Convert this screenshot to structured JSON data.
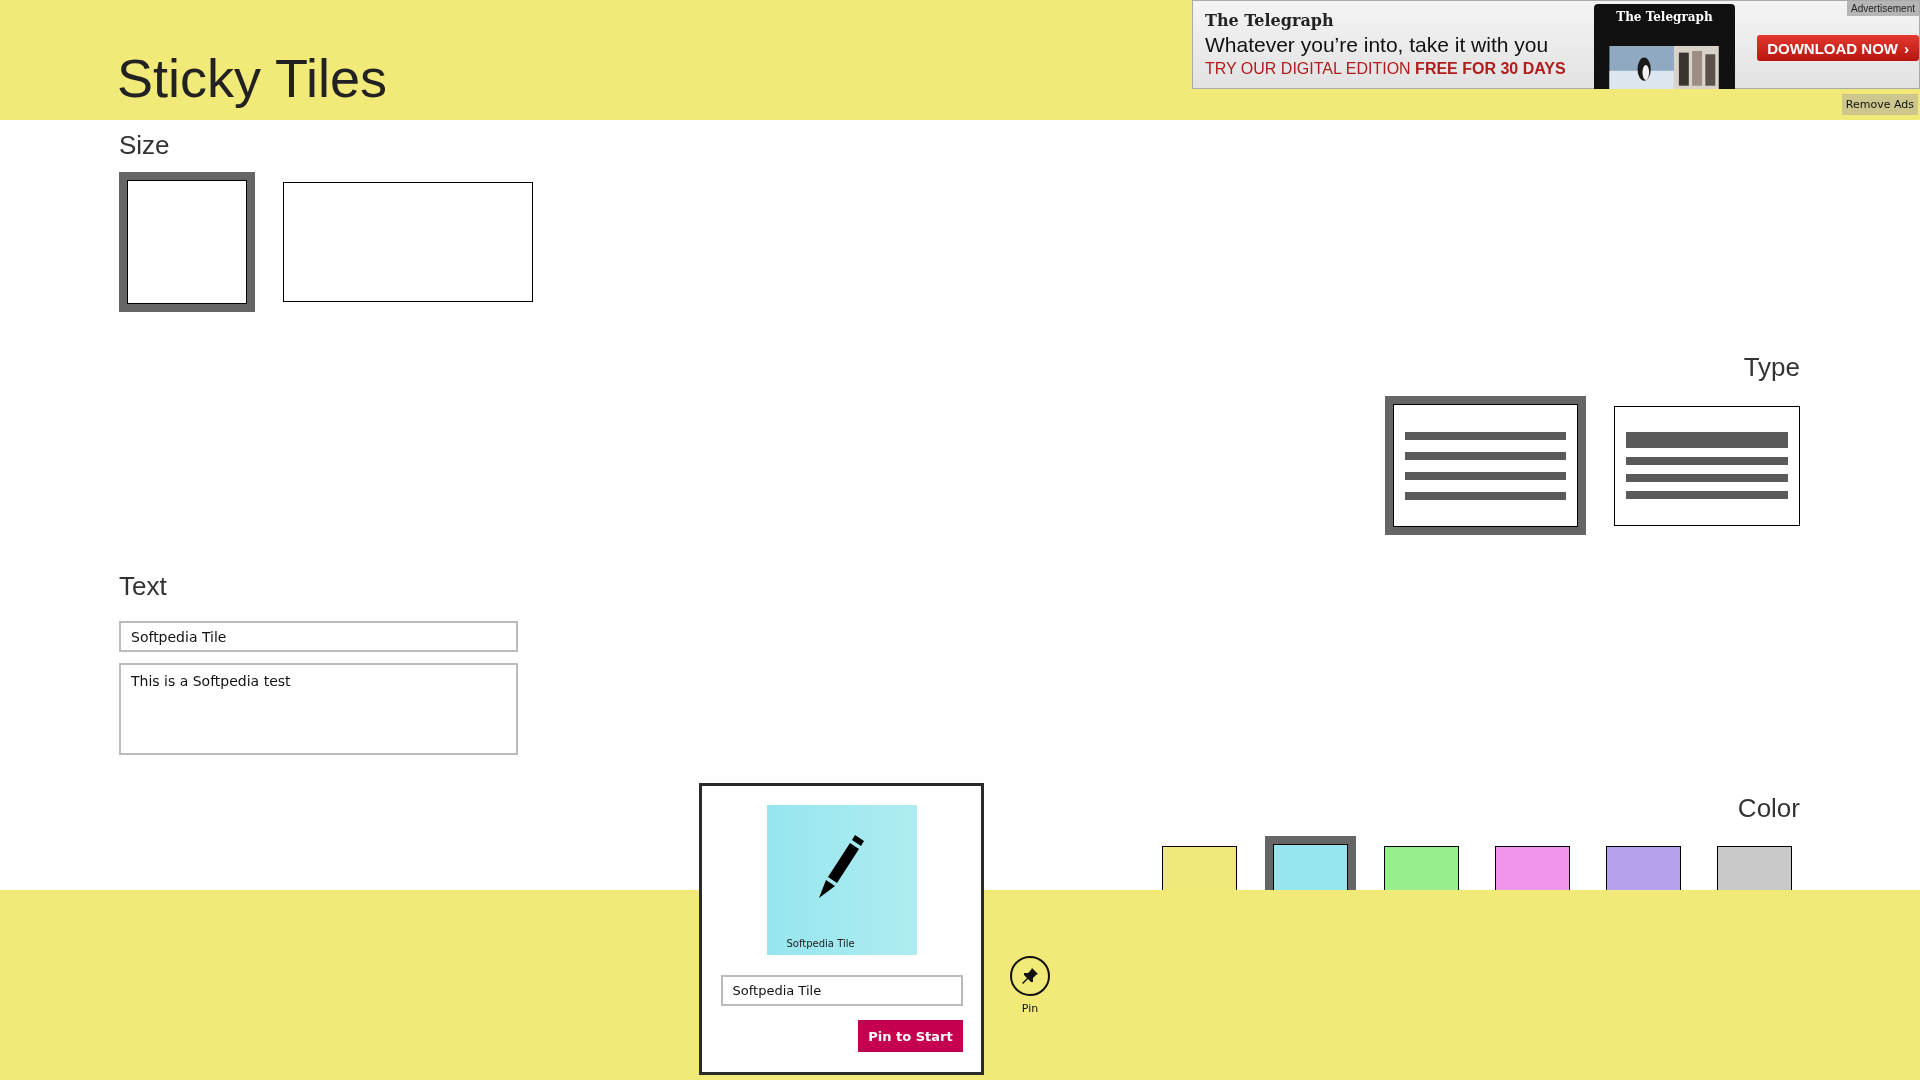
{
  "app": {
    "title": "Sticky Tiles"
  },
  "ad": {
    "brand": "The Telegraph",
    "headline": "Whatever you’re into, take it with you",
    "offer": "TRY OUR DIGITAL EDITION **FREE FOR 30 DAYS**",
    "device_brand": "The Telegraph",
    "cta": "DOWNLOAD NOW",
    "cta_icon": "›",
    "label": "Advertisement"
  },
  "remove_ads": "Remove Ads",
  "size": {
    "label": "Size",
    "options": [
      {
        "kind": "square",
        "selected": true
      },
      {
        "kind": "wide",
        "selected": false
      }
    ]
  },
  "type": {
    "label": "Type",
    "options": [
      {
        "kind": "lines",
        "selected": true
      },
      {
        "kind": "heading",
        "selected": false
      }
    ]
  },
  "text": {
    "label": "Text",
    "title_value": "Softpedia Tile",
    "body_value": "This is a Softpedia test"
  },
  "color": {
    "label": "Color",
    "swatches": [
      {
        "color": "#f0e87a",
        "selected": false
      },
      {
        "color": "#96e6ef",
        "selected": true
      },
      {
        "color": "#96ee8c",
        "selected": false
      },
      {
        "color": "#ef96ec",
        "selected": false
      },
      {
        "color": "#b6a2ec",
        "selected": false
      },
      {
        "color": "#c8c8c8",
        "selected": false
      }
    ]
  },
  "flyout": {
    "tile_label": "Softpedia Tile",
    "name_value": "Softpedia Tile",
    "button": "Pin to Start"
  },
  "app_bar": {
    "buttons": [
      {
        "label": "Pin"
      }
    ]
  }
}
